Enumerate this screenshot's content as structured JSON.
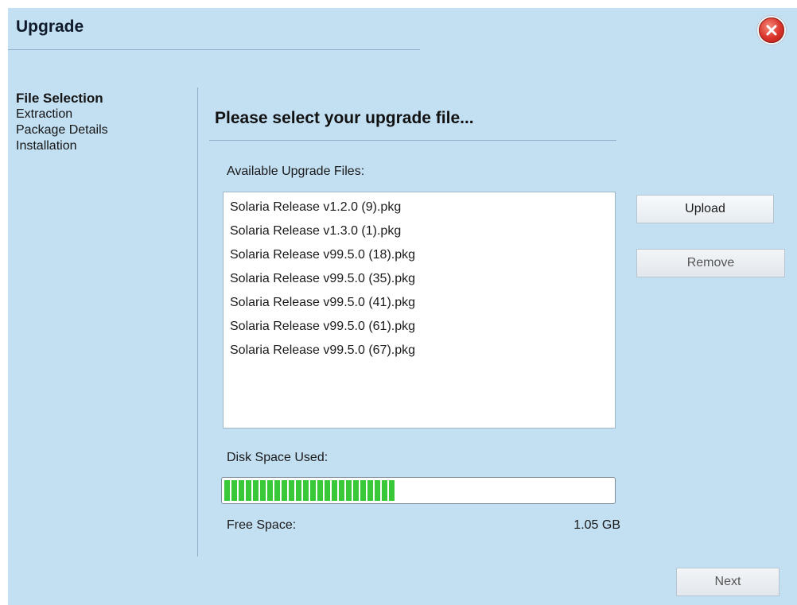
{
  "window": {
    "title": "Upgrade"
  },
  "steps": [
    {
      "label": "File Selection",
      "active": true
    },
    {
      "label": "Extraction",
      "active": false
    },
    {
      "label": "Package Details",
      "active": false
    },
    {
      "label": "Installation",
      "active": false
    }
  ],
  "main": {
    "heading": "Please select your upgrade file...",
    "files_label": "Available Upgrade Files:",
    "files": [
      "Solaria Release v1.2.0 (9).pkg",
      "Solaria Release v1.3.0 (1).pkg",
      "Solaria Release v99.5.0 (18).pkg",
      "Solaria Release v99.5.0 (35).pkg",
      "Solaria Release v99.5.0 (41).pkg",
      "Solaria Release v99.5.0 (61).pkg",
      "Solaria Release v99.5.0 (67).pkg"
    ],
    "disk_label": "Disk Space Used:",
    "disk_used_fraction": 0.44,
    "free_label": "Free Space:",
    "free_value": "1.05 GB"
  },
  "buttons": {
    "upload": "Upload",
    "remove": "Remove",
    "next": "Next"
  },
  "icons": {
    "close": "close-icon"
  },
  "colors": {
    "background": "#c3dff2",
    "progress": "#38c838",
    "close": "#d9322a"
  }
}
